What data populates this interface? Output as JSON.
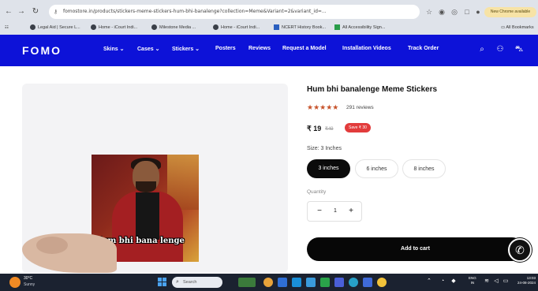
{
  "browser": {
    "url": "fomostore.in/products/stickers-meme-stickers-hum-bhi-banalenge?collection=Meme&Variant=2&variant_id=...",
    "profile_badge": "New Chrome available",
    "bookmarks": [
      {
        "label": "Legal Aid | Secure L..."
      },
      {
        "label": "Home - iCourt Indi..."
      },
      {
        "label": "Milestone Media ..."
      },
      {
        "label": "Home - iCourt Indi..."
      },
      {
        "label": "NCERT History Book..."
      },
      {
        "label": "All Accessibility Sign..."
      }
    ],
    "all_bookmarks": "All Bookmarks"
  },
  "header": {
    "logo": "FOMO",
    "nav": [
      "Skins ⌄",
      "Cases ⌄",
      "Stickers ⌄",
      "Posters",
      "Reviews",
      "Request a Model",
      "Installation Videos",
      "Track Order"
    ]
  },
  "product": {
    "title": "Hum bhi banalenge Meme Stickers",
    "stars": "★★★★★",
    "rating": 5,
    "reviews": "291 reviews",
    "price": "₹ 19",
    "compare_price": "₹49",
    "sale_badge": "Save ₹ 30",
    "size_label": "Size: 3 Inches",
    "sizes": [
      "3 inches",
      "6 inches",
      "8 inches"
    ],
    "selected_size": "3 inches",
    "quantity_label": "Quantity",
    "quantity": "1",
    "add_to_cart": "Add to cart",
    "image_caption": "Hum bhi bana lenge"
  },
  "taskbar": {
    "temp": "30°C",
    "weather": "Sunny",
    "search_placeholder": "Search",
    "lang_line1": "ENG",
    "lang_line2": "IN",
    "time": "13:03",
    "date": "24-08-2024"
  },
  "colors": {
    "header_bg": "#0d12d8",
    "star": "#c7532b",
    "sale": "#e23b3b",
    "button": "#070707"
  }
}
